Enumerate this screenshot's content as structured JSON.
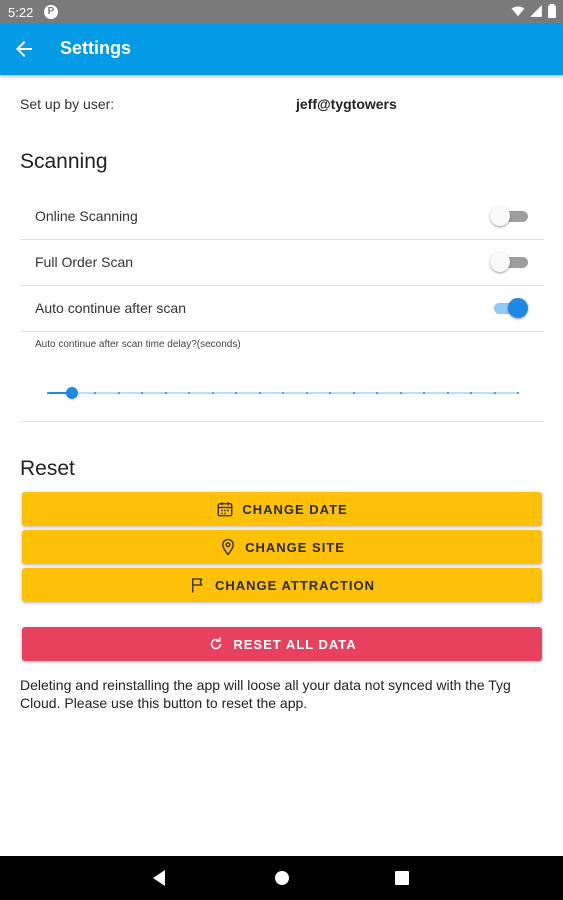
{
  "status_bar": {
    "time": "5:22",
    "app_icon_letter": "P"
  },
  "app_bar": {
    "title": "Settings",
    "back_icon": "arrow-back-icon",
    "color": "#039be5"
  },
  "setup": {
    "label": "Set up by user:",
    "value": "jeff@tygtowers"
  },
  "scanning": {
    "title": "Scanning",
    "toggles": [
      {
        "label": "Online Scanning",
        "on": false
      },
      {
        "label": "Full Order Scan",
        "on": false
      },
      {
        "label": "Auto continue after scan",
        "on": true
      }
    ],
    "slider": {
      "caption": "Auto continue after scan time delay?(seconds)",
      "min": 0,
      "max": 20,
      "value": 1,
      "steps": 20
    }
  },
  "reset": {
    "title": "Reset",
    "buttons": [
      {
        "label": "CHANGE DATE",
        "icon": "calendar-icon"
      },
      {
        "label": "CHANGE SITE",
        "icon": "location-pin-icon"
      },
      {
        "label": "CHANGE ATTRACTION",
        "icon": "flag-icon"
      }
    ],
    "reset_all": {
      "label": "RESET ALL DATA",
      "icon": "refresh-icon"
    },
    "note": "Deleting and reinstalling the app will loose all your data not synced with the Tyg Cloud. Please use this button to reset the app."
  },
  "colors": {
    "accent": "#1e88e5",
    "warning_button": "#ffc107",
    "danger_button": "#e8415e"
  }
}
